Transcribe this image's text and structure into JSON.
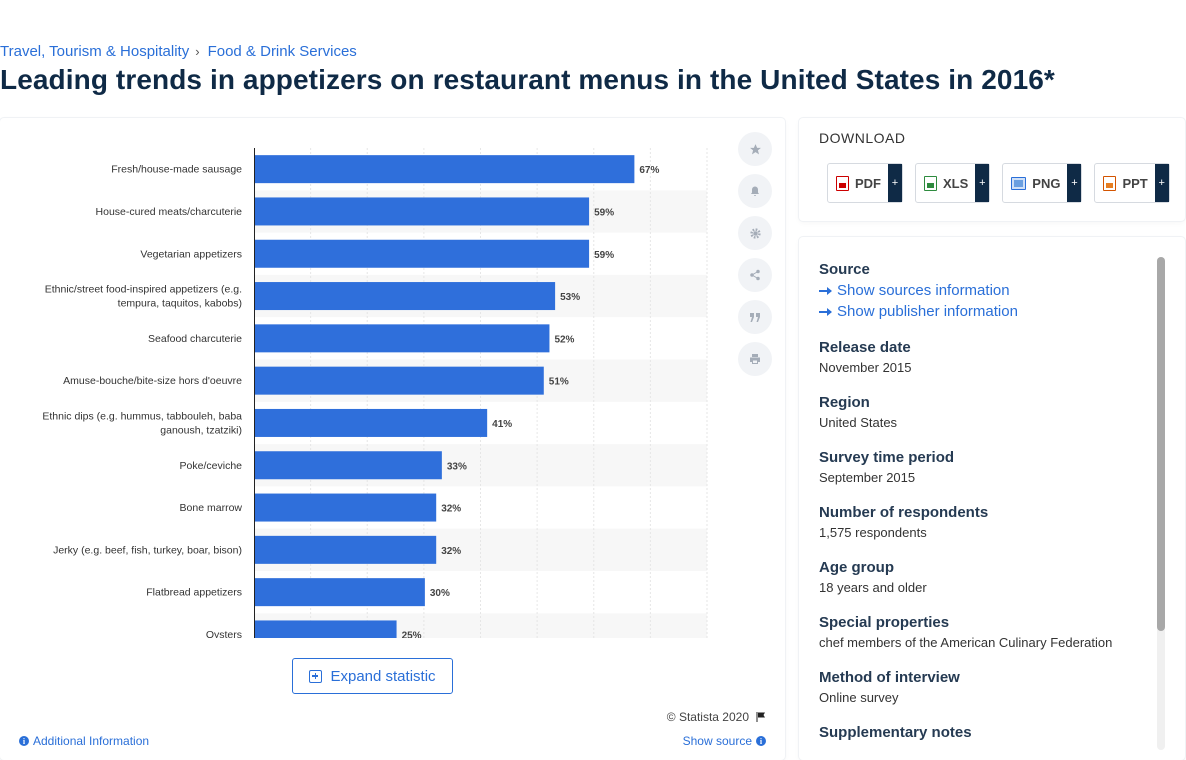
{
  "breadcrumb": {
    "items": [
      "Travel, Tourism & Hospitality",
      "Food & Drink Services"
    ],
    "separator": "›"
  },
  "title": "Leading trends in appetizers on restaurant menus in the United States in 2016*",
  "chart_data": {
    "type": "bar",
    "orientation": "horizontal",
    "categories": [
      [
        "Fresh/house-made sausage"
      ],
      [
        "House-cured meats/charcuterie"
      ],
      [
        "Vegetarian appetizers"
      ],
      [
        "Ethnic/street food-inspired appetizers (e.g.",
        "tempura, taquitos, kabobs)"
      ],
      [
        "Seafood charcuterie"
      ],
      [
        "Amuse-bouche/bite-size hors d'oeuvre"
      ],
      [
        "Ethnic dips (e.g. hummus, tabbouleh, baba",
        "ganoush, tzatziki)"
      ],
      [
        "Poke/ceviche"
      ],
      [
        "Bone marrow"
      ],
      [
        "Jerky (e.g. beef, fish, turkey, boar, bison)"
      ],
      [
        "Flatbread appetizers"
      ],
      [
        "Oysters"
      ]
    ],
    "values": [
      67,
      59,
      59,
      53,
      52,
      51,
      41,
      33,
      32,
      32,
      30,
      25
    ],
    "value_suffix": "%",
    "xlim": [
      0,
      80
    ],
    "bar_color": "#2f6fdb",
    "grid": true
  },
  "toolbar_icons": [
    "star-icon",
    "bell-icon",
    "gear-icon",
    "share-icon",
    "quote-icon",
    "print-icon"
  ],
  "expand_label": "Expand statistic",
  "copyright": "© Statista 2020",
  "additional_info": "Additional Information",
  "show_source": "Show source",
  "download": {
    "title": "DOWNLOAD",
    "buttons": [
      "PDF",
      "XLS",
      "PNG",
      "PPT"
    ],
    "plus": "+"
  },
  "details": {
    "source_label": "Source",
    "show_sources": "Show sources information",
    "show_publisher": "Show publisher information",
    "fields": [
      {
        "label": "Release date",
        "value": "November 2015"
      },
      {
        "label": "Region",
        "value": "United States"
      },
      {
        "label": "Survey time period",
        "value": "September 2015"
      },
      {
        "label": "Number of respondents",
        "value": "1,575 respondents"
      },
      {
        "label": "Age group",
        "value": "18 years and older"
      },
      {
        "label": "Special properties",
        "value": "chef members of the American Culinary Federation"
      },
      {
        "label": "Method of interview",
        "value": "Online survey"
      },
      {
        "label": "Supplementary notes",
        "value": ""
      }
    ]
  }
}
